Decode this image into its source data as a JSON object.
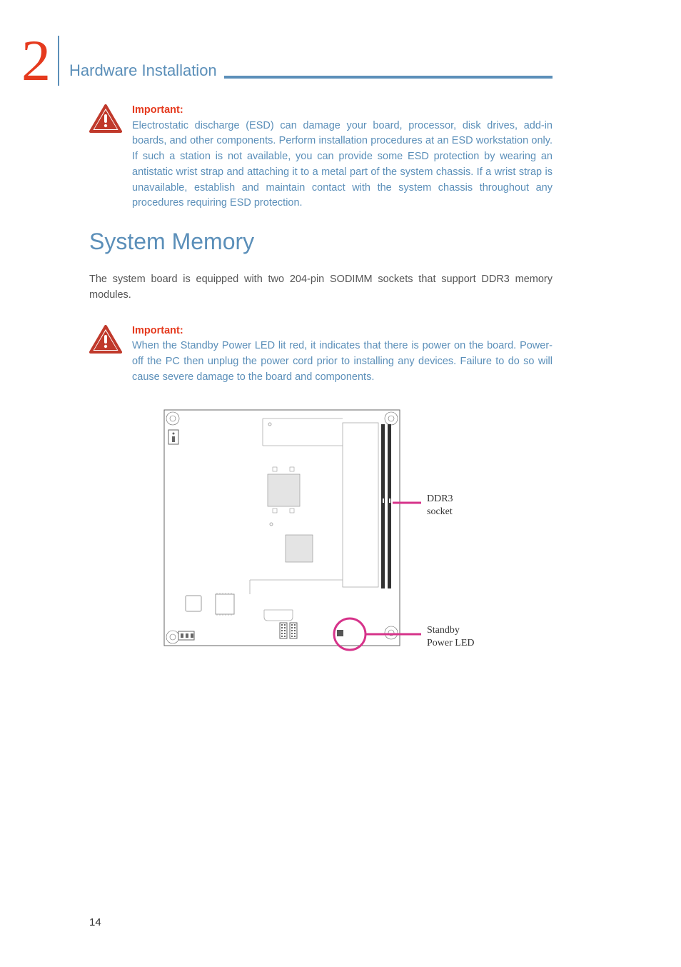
{
  "chapter_number": "2",
  "section_title": "Hardware Installation",
  "heading": "System Memory",
  "important1": {
    "label": "Important:",
    "text": "Electrostatic discharge (ESD) can damage your board, processor, disk drives, add-in boards, and other components. Perform installation procedures at an ESD workstation only. If such a station is not available, you can provide some ESD protection by wearing an antistatic wrist strap and attaching it to a metal part of the system chassis. If a wrist strap is unavailable, establish and maintain contact with the system chassis throughout any procedures requiring ESD protection."
  },
  "body1": "The system board is equipped with two 204-pin SODIMM sockets that support DDR3 memory modules.",
  "important2": {
    "label": "Important:",
    "text": "When the Standby Power LED lit red, it indicates that there is power on the board. Power-off the PC then unplug the power cord prior to installing any devices. Failure to do so will cause severe damage to the board and components."
  },
  "diagram": {
    "label_ddr3_line1": "DDR3",
    "label_ddr3_line2": "socket",
    "label_led_line1": "Standby",
    "label_led_line2": "Power LED"
  },
  "page_number": "14"
}
